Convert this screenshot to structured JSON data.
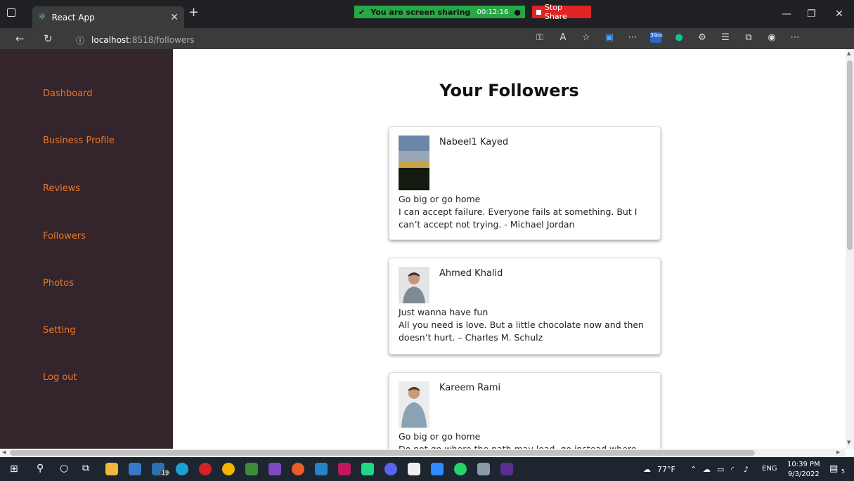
{
  "browser": {
    "tab_title": "React App",
    "share_text": "You are screen sharing",
    "share_timer": "00:12:16",
    "stop_share": "Stop Share",
    "url_host": "localhost",
    "url_path": ":8518/followers",
    "update_badge": "39m"
  },
  "sidebar": {
    "items": [
      {
        "label": "Dashboard"
      },
      {
        "label": "Business Profile"
      },
      {
        "label": "Reviews"
      },
      {
        "label": "Followers"
      },
      {
        "label": "Photos"
      },
      {
        "label": "Setting"
      },
      {
        "label": "Log out"
      }
    ]
  },
  "page": {
    "title": "Your Followers",
    "followers": [
      {
        "name": "Nabeel1 Kayed",
        "status": "Go big or go home",
        "quote": "I can accept failure. Everyone fails at something. But I can’t accept not trying. - Michael Jordan"
      },
      {
        "name": "Ahmed Khalid",
        "status": "Just wanna have fun",
        "quote": "All you need is love. But a little chocolate now and then doesn’t hurt. – Charles M. Schulz"
      },
      {
        "name": "Kareem Rami",
        "status": "Go big or go home",
        "quote": "Do not go where the path may lead, go instead where"
      }
    ]
  },
  "taskbar": {
    "weather": "77°F",
    "lang": "ENG",
    "time": "10:39 PM",
    "date": "9/3/2022",
    "notif_count": "5",
    "mail_badge": "19"
  },
  "colors": {
    "sidebar_bg": "#34242b",
    "sidebar_link": "#e8782a",
    "share_green": "#27a844",
    "stop_red": "#e02424"
  }
}
